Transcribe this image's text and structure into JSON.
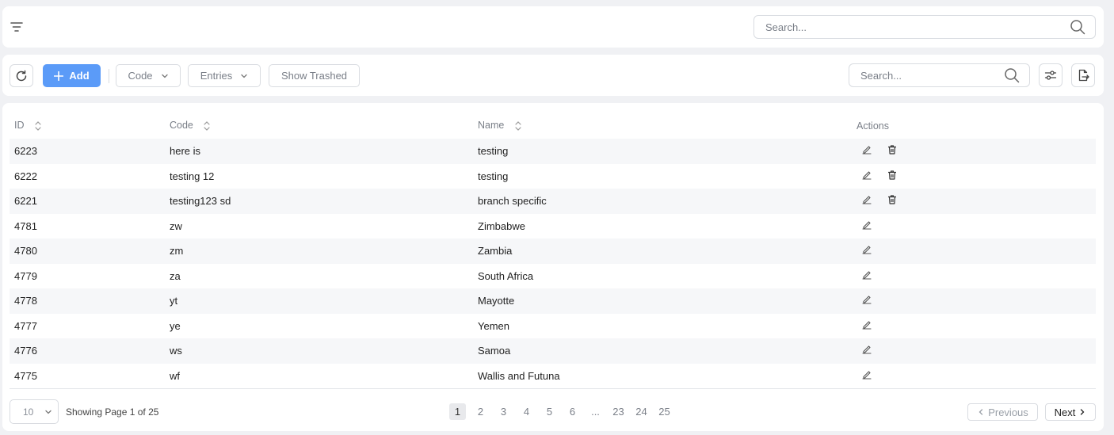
{
  "topbar": {
    "search_placeholder": "Search..."
  },
  "toolbar": {
    "add_label": "Add",
    "code_label": "Code",
    "entries_label": "Entries",
    "show_trashed_label": "Show Trashed",
    "search_placeholder": "Search..."
  },
  "table": {
    "headers": {
      "id": "ID",
      "code": "Code",
      "name": "Name",
      "actions": "Actions"
    },
    "rows": [
      {
        "id": "6223",
        "code": "here is",
        "name": "testing",
        "deletable": true
      },
      {
        "id": "6222",
        "code": "testing 12",
        "name": "testing",
        "deletable": true
      },
      {
        "id": "6221",
        "code": "testing123 sd",
        "name": "branch specific",
        "deletable": true
      },
      {
        "id": "4781",
        "code": "zw",
        "name": "Zimbabwe",
        "deletable": false
      },
      {
        "id": "4780",
        "code": "zm",
        "name": "Zambia",
        "deletable": false
      },
      {
        "id": "4779",
        "code": "za",
        "name": "South Africa",
        "deletable": false
      },
      {
        "id": "4778",
        "code": "yt",
        "name": "Mayotte",
        "deletable": false
      },
      {
        "id": "4777",
        "code": "ye",
        "name": "Yemen",
        "deletable": false
      },
      {
        "id": "4776",
        "code": "ws",
        "name": "Samoa",
        "deletable": false
      },
      {
        "id": "4775",
        "code": "wf",
        "name": "Wallis and Futuna",
        "deletable": false
      }
    ]
  },
  "pagination": {
    "page_size": "10",
    "info": "Showing Page 1 of 25",
    "pages": [
      "1",
      "2",
      "3",
      "4",
      "5",
      "6",
      "...",
      "23",
      "24",
      "25"
    ],
    "current": "1",
    "previous_label": "Previous",
    "next_label": "Next"
  },
  "colors": {
    "primary": "#5b9bf8",
    "row_stripe": "#f6f7f9"
  },
  "icons": [
    "filter-icon",
    "search-icon",
    "refresh-icon",
    "plus-icon",
    "chevron-down-icon",
    "settings-sliders-icon",
    "export-icon",
    "sort-icon",
    "edit-icon",
    "trash-icon",
    "chevron-left-icon",
    "chevron-right-icon"
  ]
}
